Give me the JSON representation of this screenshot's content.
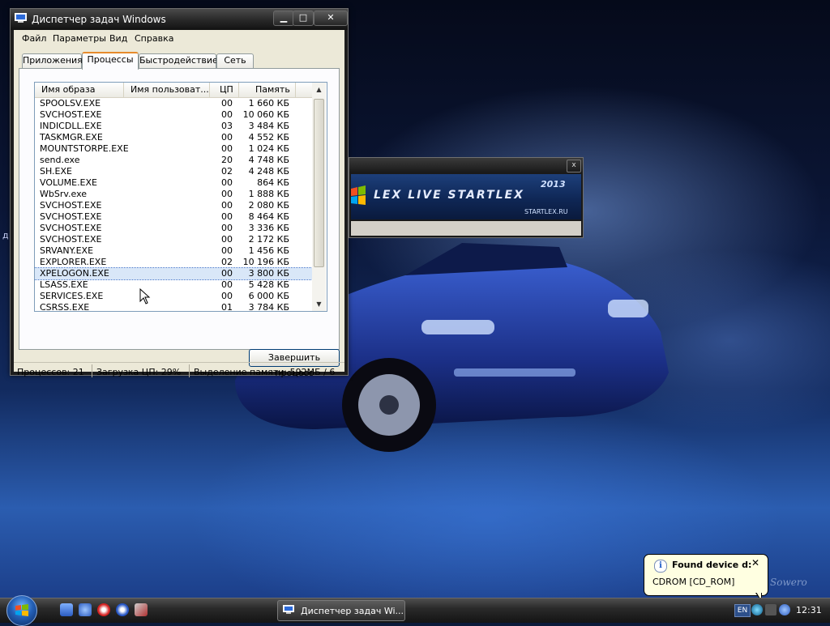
{
  "desktop": {
    "edge_text": "д",
    "signature": "Sowero"
  },
  "task_manager": {
    "title": "Диспетчер задач Windows",
    "caption_buttons": {
      "minimize": "▁",
      "maximize": "□",
      "close": "✕"
    },
    "menu": [
      {
        "label": "Файл"
      },
      {
        "label": "Параметры"
      },
      {
        "label": "Вид"
      },
      {
        "label": "Справка"
      }
    ],
    "tabs": [
      {
        "label": "Приложения"
      },
      {
        "label": "Процессы"
      },
      {
        "label": "Быстродействие"
      },
      {
        "label": "Сеть"
      }
    ],
    "active_tab": "Процессы",
    "columns": [
      "Имя образа",
      "Имя пользоват...",
      "ЦП",
      "Память"
    ],
    "processes": [
      {
        "name": "SPOOLSV.EXE",
        "cpu": "00",
        "mem": "1 660 КБ"
      },
      {
        "name": "SVCHOST.EXE",
        "cpu": "00",
        "mem": "10 060 КБ"
      },
      {
        "name": "INDICDLL.EXE",
        "cpu": "03",
        "mem": "3 484 КБ"
      },
      {
        "name": "TASKMGR.EXE",
        "cpu": "00",
        "mem": "4 552 КБ"
      },
      {
        "name": "MOUNTSTORPE.EXE",
        "cpu": "00",
        "mem": "1 024 КБ"
      },
      {
        "name": "send.exe",
        "cpu": "20",
        "mem": "4 748 КБ"
      },
      {
        "name": "SH.EXE",
        "cpu": "02",
        "mem": "4 248 КБ"
      },
      {
        "name": "VOLUME.EXE",
        "cpu": "00",
        "mem": "864 КБ"
      },
      {
        "name": "WbSrv.exe",
        "cpu": "00",
        "mem": "1 888 КБ"
      },
      {
        "name": "SVCHOST.EXE",
        "cpu": "00",
        "mem": "2 080 КБ"
      },
      {
        "name": "SVCHOST.EXE",
        "cpu": "00",
        "mem": "8 464 КБ"
      },
      {
        "name": "SVCHOST.EXE",
        "cpu": "00",
        "mem": "3 336 КБ"
      },
      {
        "name": "SVCHOST.EXE",
        "cpu": "00",
        "mem": "2 172 КБ"
      },
      {
        "name": "SRVANY.EXE",
        "cpu": "00",
        "mem": "1 456 КБ"
      },
      {
        "name": "EXPLORER.EXE",
        "cpu": "02",
        "mem": "10 196 КБ"
      },
      {
        "name": "XPELOGON.EXE",
        "cpu": "00",
        "mem": "3 800 КБ",
        "selected": true
      },
      {
        "name": "LSASS.EXE",
        "cpu": "00",
        "mem": "5 428 КБ"
      },
      {
        "name": "SERVICES.EXE",
        "cpu": "00",
        "mem": "6 000 КБ"
      },
      {
        "name": "CSRSS.EXE",
        "cpu": "01",
        "mem": "3 784 КБ"
      }
    ],
    "end_process_label": "Завершить процесс",
    "status": {
      "processes": "Процессов: 21",
      "cpu": "Загрузка ЦП: 29%",
      "memory": "Выделение памяти: 592МБ / 6"
    }
  },
  "splash": {
    "close": "x",
    "name": "LEX LIVE STARTLEX",
    "year": "2013",
    "url": "STARTLEX.RU"
  },
  "balloon": {
    "title": "Found device d:",
    "text": "CDROM    [CD_ROM]",
    "close": "✕",
    "info_glyph": "i"
  },
  "taskbar": {
    "task_label": "Диспетчер задач Wi...",
    "lang": "EN",
    "clock": "12:31"
  },
  "colors": {
    "selection": "#d9e7f8",
    "active_tab_accent": "#e68b2c",
    "balloon_bg": "#ffffe1"
  }
}
